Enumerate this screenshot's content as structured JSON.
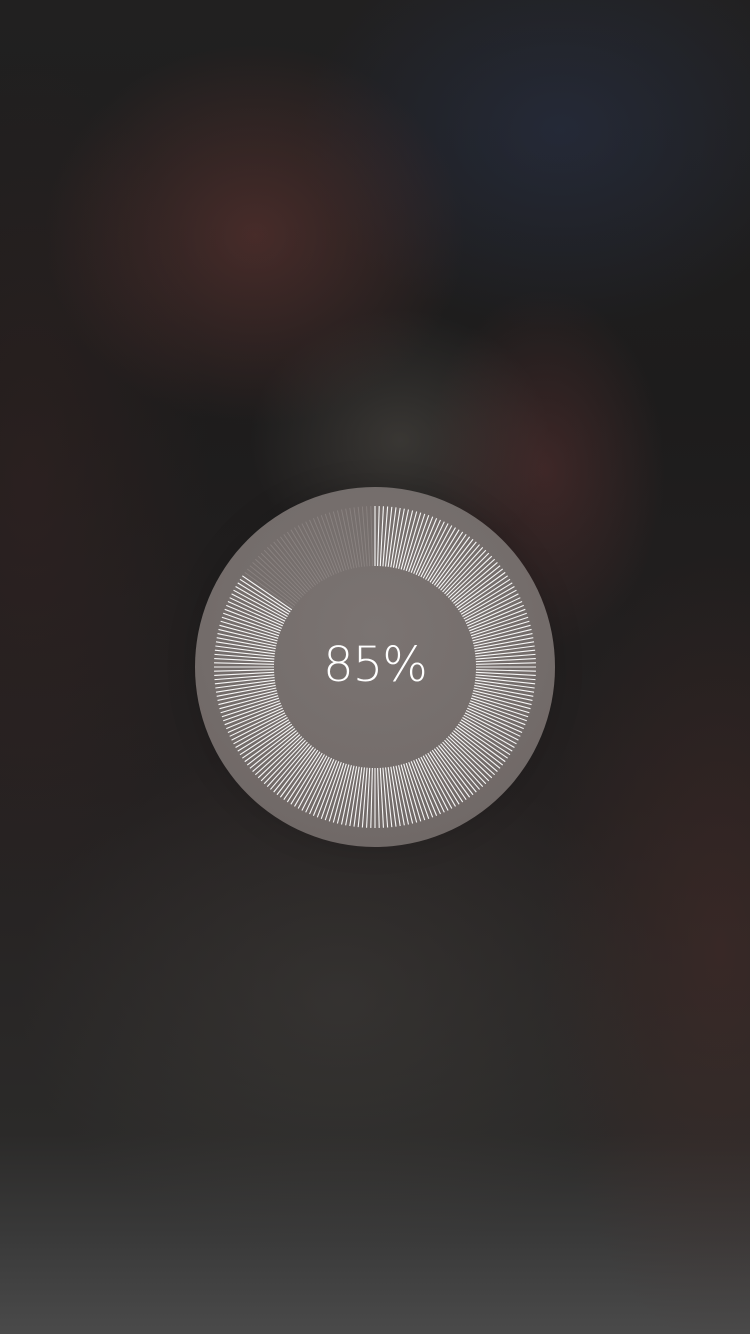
{
  "progress": {
    "fraction": 0.85,
    "label": "85%"
  },
  "colors": {
    "tick_active": "#ffffff",
    "tick_inactive": "#9a9391",
    "dial_face": "#746d6b"
  }
}
